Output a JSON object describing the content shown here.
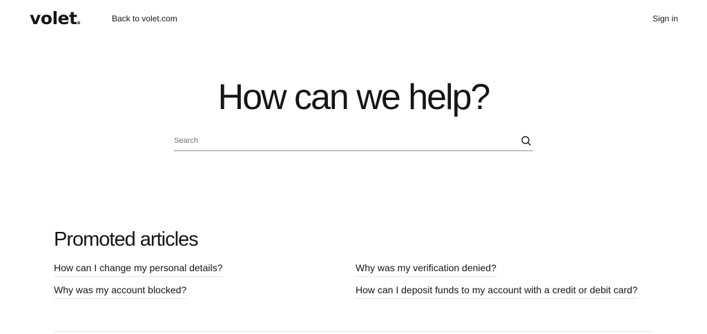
{
  "header": {
    "logo_text": "volet",
    "back_link_label": "Back to volet.com",
    "sign_in_label": "Sign in"
  },
  "hero": {
    "title": "How can we help?",
    "search": {
      "placeholder": "Search",
      "value": "",
      "icon": "search-icon"
    }
  },
  "promoted": {
    "title": "Promoted articles",
    "articles": [
      {
        "label": "How can I change my personal details?"
      },
      {
        "label": "Why was my account blocked?"
      },
      {
        "label": "Why was my verification denied?"
      },
      {
        "label": "How can I deposit funds to my account with a credit or debit card?"
      }
    ]
  },
  "colors": {
    "text": "#131519",
    "background": "#ffffff",
    "divider": "#e3e4e6"
  }
}
